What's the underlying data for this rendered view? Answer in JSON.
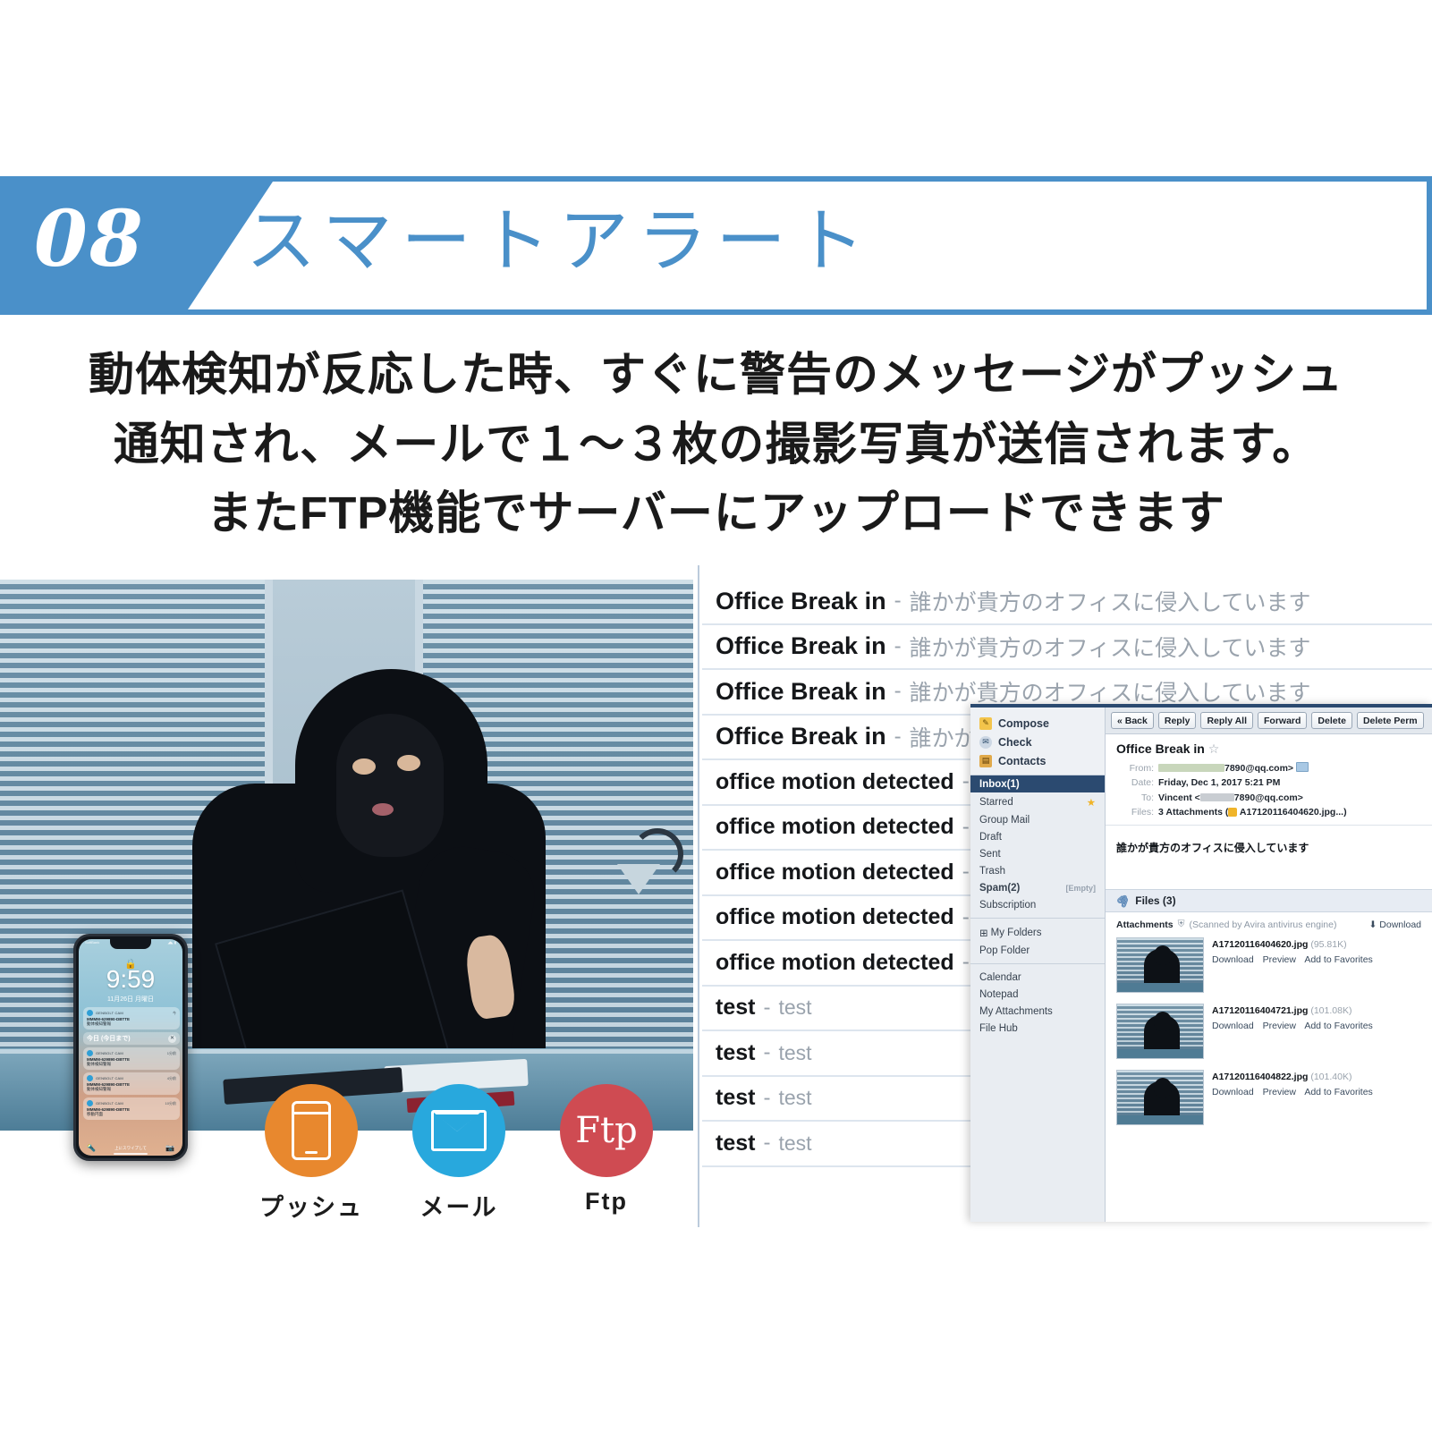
{
  "banner": {
    "number": "08",
    "title": "スマートアラート",
    "accent_blue": "#4a90c9"
  },
  "lead": {
    "line1": "動体検知が反応した時、すぐに警告のメッセージがプッシュ",
    "line2": "通知され、メールで１〜３枚の撮影写真が送信されます。",
    "line3": "またFTP機能でサーバーにアップロードできます"
  },
  "phone": {
    "carrier": "SoftBank",
    "status_right": "◢◣ ▮",
    "lock_icon": "🔒",
    "time": "9:59",
    "date": "11月26日 月曜日",
    "today_label": "今日 (今日まで)",
    "today_close": "✕",
    "footer_left": "上にスワイプして",
    "footer_left_sub": "ロック解除",
    "flashlight_icon": "🔦",
    "camera_icon": "📷",
    "notifications": [
      {
        "app": "GENBOLT CAM",
        "time": "今",
        "line1": "MMMM-629890-DBTTE",
        "line2": "動体検知警報"
      },
      {
        "app": "GENBOLT CAM",
        "time": "1分前",
        "line1": "MMMM-629890-DBTTE",
        "line2": "動体検知警報"
      },
      {
        "app": "GENBOLT CAM",
        "time": "4分前",
        "line1": "MMMM-629890-DBTTE",
        "line2": "動体検知警報"
      },
      {
        "app": "GENBOLT CAM",
        "time": "10分前",
        "line1": "MMMM-629890-DBTTE",
        "line2": "移動円面"
      }
    ]
  },
  "features": [
    {
      "id": "push",
      "icon": "phone-icon",
      "label": "プッシュ",
      "color": "#e8882e",
      "text": ""
    },
    {
      "id": "mail",
      "icon": "envelope-icon",
      "label": "メール",
      "color": "#28a8dd",
      "text": ""
    },
    {
      "id": "ftp",
      "icon": "ftp-text-icon",
      "label": "Ftp",
      "color": "#cf4b52",
      "text": "Ftp"
    }
  ],
  "mail_list": [
    {
      "subject": "Office Break in",
      "snippet": "誰かが貴方のオフィスに侵入しています",
      "size": "big"
    },
    {
      "subject": "Office Break in",
      "snippet": "誰かが貴方のオフィスに侵入しています",
      "size": "big"
    },
    {
      "subject": "Office Break in",
      "snippet": "誰かが貴方のオフィスに侵入しています",
      "size": "big"
    },
    {
      "subject": "Office Break in",
      "snippet": "誰かが貴方のオフィスに侵入しています",
      "size": "big"
    },
    {
      "subject": "office motion detected",
      "snippet": "",
      "size": "small"
    },
    {
      "subject": "office motion detected",
      "snippet": "",
      "size": "small"
    },
    {
      "subject": "office motion detected",
      "snippet": "",
      "size": "small"
    },
    {
      "subject": "office motion detected",
      "snippet": "",
      "size": "small"
    },
    {
      "subject": "office motion detected",
      "snippet": "",
      "size": "small"
    },
    {
      "subject": "test",
      "snippet": "test",
      "size": "small"
    },
    {
      "subject": "test",
      "snippet": "test",
      "size": "small"
    },
    {
      "subject": "test",
      "snippet": "test",
      "size": "small"
    },
    {
      "subject": "test",
      "snippet": "test",
      "size": "small"
    }
  ],
  "sidebar": {
    "actions": [
      {
        "label": "Compose",
        "icon": "compose-icon",
        "glyph": "✎"
      },
      {
        "label": "Check",
        "icon": "check-mail-icon",
        "glyph": "✉"
      },
      {
        "label": "Contacts",
        "icon": "contacts-icon",
        "glyph": "▤"
      }
    ],
    "folders": [
      {
        "label": "Inbox(1)",
        "selected": true,
        "bold": true,
        "star": false,
        "tag": ""
      },
      {
        "label": "Starred",
        "selected": false,
        "bold": false,
        "star": true,
        "tag": ""
      },
      {
        "label": "Group Mail",
        "selected": false,
        "bold": false,
        "star": false,
        "tag": ""
      },
      {
        "label": "Draft",
        "selected": false,
        "bold": false,
        "star": false,
        "tag": ""
      },
      {
        "label": "Sent",
        "selected": false,
        "bold": false,
        "star": false,
        "tag": ""
      },
      {
        "label": "Trash",
        "selected": false,
        "bold": false,
        "star": false,
        "tag": ""
      },
      {
        "label": "Spam(2)",
        "selected": false,
        "bold": true,
        "star": false,
        "tag": "[Empty]"
      },
      {
        "label": "Subscription",
        "selected": false,
        "bold": false,
        "star": false,
        "tag": ""
      }
    ],
    "my_folders": "My Folders",
    "my_folders_expander": "⊞",
    "pop_folder": "Pop Folder",
    "tools": [
      "Calendar",
      "Notepad",
      "My Attachments",
      "File Hub"
    ]
  },
  "reader": {
    "toolbar": [
      "« Back",
      "Reply",
      "Reply All",
      "Forward",
      "Delete",
      "Delete Perm"
    ],
    "subject": "Office Break in",
    "star_icon": "☆",
    "meta": {
      "from_label": "From:",
      "from_value": "7890@qq.com>",
      "date_label": "Date:",
      "date_value": "Friday, Dec 1, 2017 5:21 PM",
      "to_label": "To:",
      "to_value_name": "Vincent",
      "to_value_rest": "7890@qq.com>",
      "files_label": "Files:",
      "files_value": "3 Attachments (",
      "files_value_end": "A17120116404620.jpg...)"
    },
    "body": "誰かが貴方のオフィスに侵入しています",
    "files_bar": "Files (3)",
    "attachments_label": "Attachments",
    "scan_note": "(Scanned by Avira antivirus engine)",
    "download_all": "Download",
    "attachments": [
      {
        "name": "A17120116404620.jpg",
        "size": "(95.81K)",
        "links": [
          "Download",
          "Preview",
          "Add to Favorites"
        ]
      },
      {
        "name": "A17120116404721.jpg",
        "size": "(101.08K)",
        "links": [
          "Download",
          "Preview",
          "Add to Favorites"
        ]
      },
      {
        "name": "A17120116404822.jpg",
        "size": "(101.40K)",
        "links": [
          "Download",
          "Preview",
          "Add to Favorites"
        ]
      }
    ]
  }
}
